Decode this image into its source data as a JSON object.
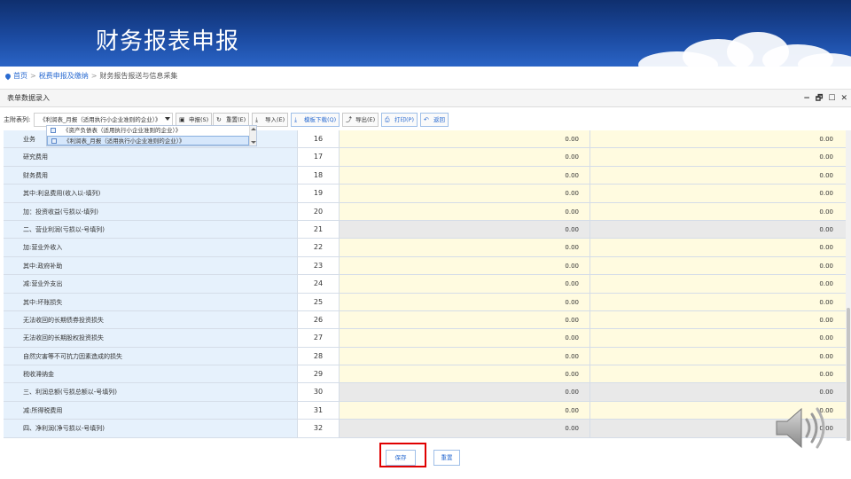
{
  "banner": {
    "title": "财务报表申报"
  },
  "breadcrumb": {
    "home": "首页",
    "level1": "税费申报及缴纳",
    "level2": "财务报告报送与信息采集",
    "sep": ">"
  },
  "panel": {
    "title": "表单数据录入",
    "controls": [
      "−",
      "🗗",
      "☐",
      "✕"
    ]
  },
  "toolbar": {
    "label": "主附表列:",
    "selected_report": "《利润表_月报（适用执行小企业准则的企业）》",
    "buttons": {
      "declare": "申报(S)",
      "reset": "重置(E)",
      "import": "导入(E)",
      "template": "模板下载(Q)",
      "export": "导出(E)",
      "print": "打印(P)",
      "back": "返回"
    }
  },
  "dropdown": {
    "options": [
      "《资产负债表（适用执行小企业准则的企业）》",
      "《利润表_月报（适用执行小企业准则的企业）》"
    ]
  },
  "table": {
    "rows": [
      {
        "label": "业务",
        "line": "16",
        "v1": "0.00",
        "v2": "0.00",
        "gray": false
      },
      {
        "label": "研究费用",
        "line": "17",
        "v1": "0.00",
        "v2": "0.00",
        "gray": false
      },
      {
        "label": "财务费用",
        "line": "18",
        "v1": "0.00",
        "v2": "0.00",
        "gray": false
      },
      {
        "label": "其中:利息费用(收入以-填列)",
        "line": "19",
        "v1": "0.00",
        "v2": "0.00",
        "gray": false
      },
      {
        "label": "加：投资收益(亏损以-填列)",
        "line": "20",
        "v1": "0.00",
        "v2": "0.00",
        "gray": false
      },
      {
        "label": "二、营业利润(亏损以-号填列)",
        "line": "21",
        "v1": "0.00",
        "v2": "0.00",
        "gray": true
      },
      {
        "label": "加:营业外收入",
        "line": "22",
        "v1": "0.00",
        "v2": "0.00",
        "gray": false
      },
      {
        "label": "其中:政府补助",
        "line": "23",
        "v1": "0.00",
        "v2": "0.00",
        "gray": false
      },
      {
        "label": "减:营业外支出",
        "line": "24",
        "v1": "0.00",
        "v2": "0.00",
        "gray": false
      },
      {
        "label": "其中:坏账损失",
        "line": "25",
        "v1": "0.00",
        "v2": "0.00",
        "gray": false
      },
      {
        "label": "无法收回的长期债券投资损失",
        "line": "26",
        "v1": "0.00",
        "v2": "0.00",
        "gray": false
      },
      {
        "label": "无法收回的长期股权投资损失",
        "line": "27",
        "v1": "0.00",
        "v2": "0.00",
        "gray": false
      },
      {
        "label": "自然灾害等不可抗力因素造成的损失",
        "line": "28",
        "v1": "0.00",
        "v2": "0.00",
        "gray": false
      },
      {
        "label": "税收滞纳金",
        "line": "29",
        "v1": "0.00",
        "v2": "0.00",
        "gray": false
      },
      {
        "label": "三、利润总额(亏损总额以-号填列)",
        "line": "30",
        "v1": "0.00",
        "v2": "0.00",
        "gray": true
      },
      {
        "label": "减:所得税费用",
        "line": "31",
        "v1": "0.00",
        "v2": "0.00",
        "gray": false
      },
      {
        "label": "四、净利润(净亏损以-号填列)",
        "line": "32",
        "v1": "0.00",
        "v2": "0.00",
        "gray": true
      }
    ]
  },
  "footer": {
    "save": "保存",
    "reset": "重置"
  },
  "colors": {
    "banner": "#1b4aa0",
    "accent": "#2a6bd1",
    "highlight": "#e00000",
    "input": "#fffbe0",
    "label_bg": "#e6f1fc"
  },
  "icons": {
    "speaker": "speaker-icon"
  }
}
